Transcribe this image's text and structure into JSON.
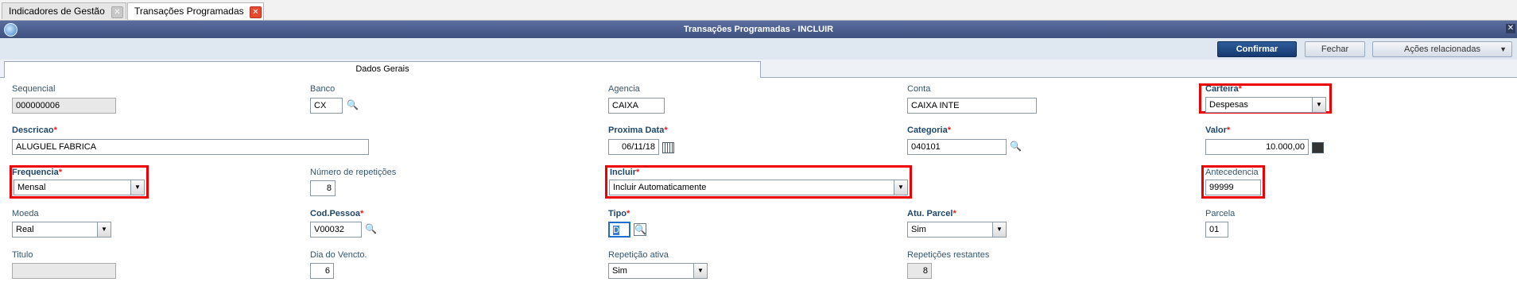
{
  "tabs": [
    {
      "label": "Indicadores de Gestão",
      "active": false
    },
    {
      "label": "Transações Programadas",
      "active": true
    }
  ],
  "window": {
    "title": "Transações Programadas - INCLUIR"
  },
  "toolbar": {
    "confirm": "Confirmar",
    "close": "Fechar",
    "related": "Ações relacionadas"
  },
  "folder": {
    "label": "Dados Gerais"
  },
  "fields": {
    "sequencial": {
      "label": "Sequencial",
      "value": "000000006"
    },
    "banco": {
      "label": "Banco",
      "value": "CX"
    },
    "agencia": {
      "label": "Agencia",
      "value": "CAIXA"
    },
    "conta": {
      "label": "Conta",
      "value": "CAIXA INTE"
    },
    "carteira": {
      "label": "Carteira",
      "value": "Despesas"
    },
    "descricao": {
      "label": "Descricao",
      "value": "ALUGUEL FABRICA"
    },
    "proxima_data": {
      "label": "Proxima Data",
      "value": "06/11/18"
    },
    "categoria": {
      "label": "Categoria",
      "value": "040101"
    },
    "valor": {
      "label": "Valor",
      "value": "10.000,00"
    },
    "frequencia": {
      "label": "Frequencia",
      "value": "Mensal"
    },
    "num_repeticoes": {
      "label": "Número de repetições",
      "value": "8"
    },
    "incluir": {
      "label": "Incluir",
      "value": "Incluir Automaticamente"
    },
    "antecedencia": {
      "label": "Antecedencia",
      "value": "99999"
    },
    "moeda": {
      "label": "Moeda",
      "value": "Real"
    },
    "cod_pessoa": {
      "label": "Cod.Pessoa",
      "value": "V00032"
    },
    "tipo": {
      "label": "Tipo",
      "value": "D"
    },
    "atu_parcel": {
      "label": "Atu. Parcel",
      "value": "Sim"
    },
    "parcela": {
      "label": "Parcela",
      "value": "01"
    },
    "titulo": {
      "label": "Titulo",
      "value": ""
    },
    "dia_vencto": {
      "label": "Dia do Vencto.",
      "value": "6"
    },
    "repeticao_ativa": {
      "label": "Repetição ativa",
      "value": "Sim"
    },
    "repeticoes_restantes": {
      "label": "Repetições restantes",
      "value": "8"
    }
  },
  "required_mark": "*",
  "icons": {
    "lookup": "search-icon",
    "calendar": "calendar-icon",
    "calculator": "calculator-icon",
    "dropdown": "chevron-down-icon",
    "close_tab": "close-icon"
  },
  "colors": {
    "title_bar": "#3e517f",
    "label": "#34566f",
    "required": "#e41c1c",
    "highlight": "#ee0000",
    "confirm_button": "#173a6f"
  }
}
